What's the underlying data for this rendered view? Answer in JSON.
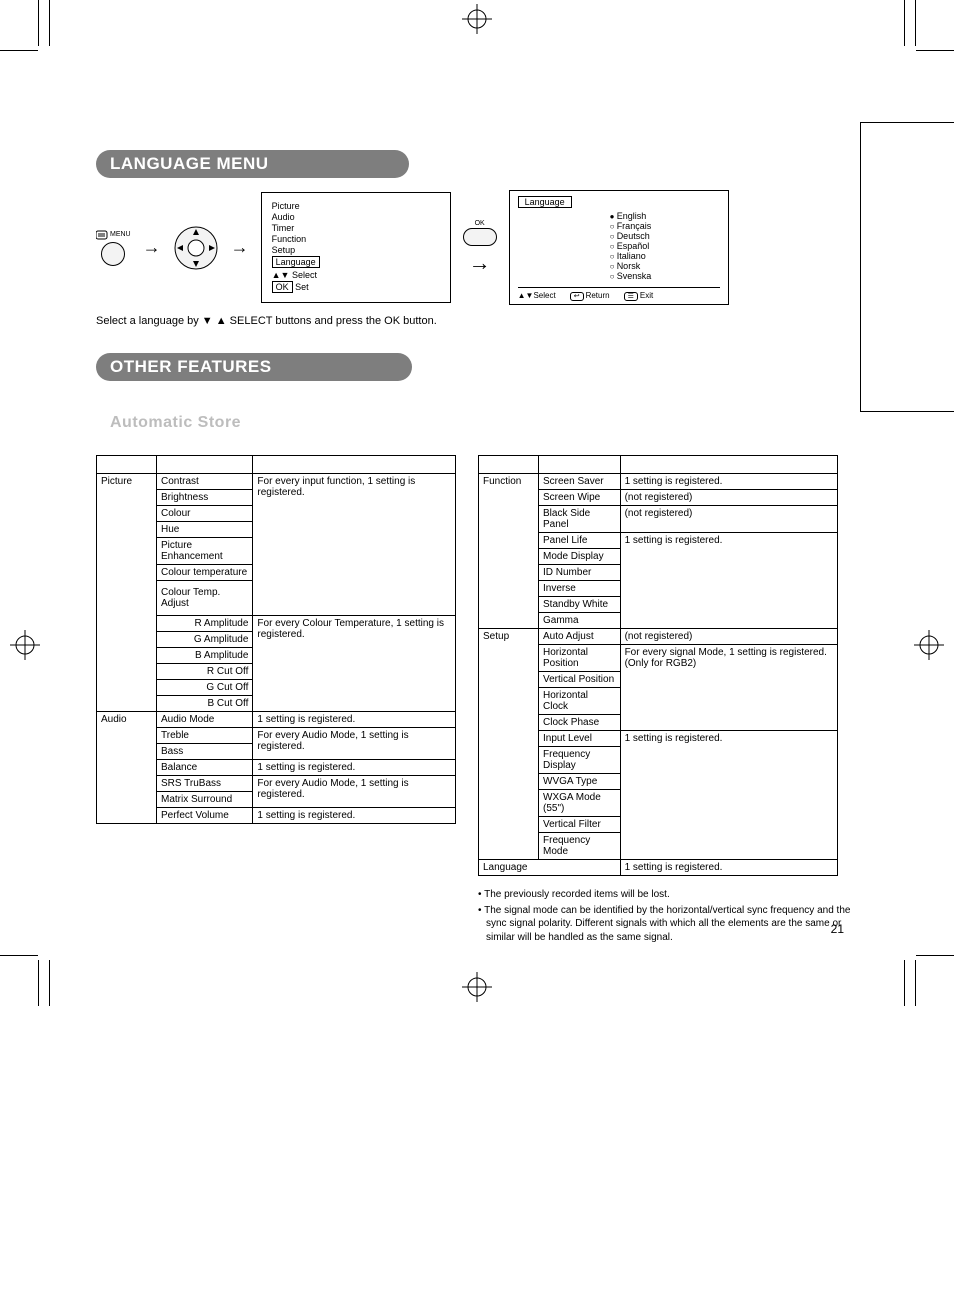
{
  "page_number": "21",
  "headers": {
    "language_menu": "LANGUAGE MENU",
    "other_features": "OTHER FEATURES",
    "automatic_store": "Automatic Store"
  },
  "flow": {
    "menu_button_label": "MENU",
    "ok_button_label": "OK",
    "osd_main": {
      "items": [
        "Picture",
        "Audio",
        "Timer",
        "Function",
        "Setup",
        "Language"
      ],
      "select_hint": "Select",
      "set_hint": "Set",
      "ok_label": "OK"
    },
    "osd_language": {
      "title": "Language",
      "options": [
        "English",
        "Français",
        "Deutsch",
        "Español",
        "Italiano",
        "Norsk",
        "Svenska"
      ],
      "selected_index": 0,
      "footer_select": "Select",
      "footer_return": "Return",
      "footer_exit": "Exit"
    }
  },
  "instruction_text": "Select a language by ▼ ▲ SELECT buttons and press the OK button.",
  "settings_left": {
    "groups": [
      {
        "category": "Picture",
        "rows": [
          {
            "name": "Contrast",
            "note_ref": 0
          },
          {
            "name": "Brightness"
          },
          {
            "name": "Colour"
          },
          {
            "name": "Hue"
          },
          {
            "name": "Picture Enhancement"
          },
          {
            "name": "Colour temperature"
          },
          {
            "name": "Colour Temp. Adjust"
          },
          {
            "name": "R Amplitude",
            "indent": true,
            "note_ref": 1
          },
          {
            "name": "G Amplitude",
            "indent": true
          },
          {
            "name": "B Amplitude",
            "indent": true
          },
          {
            "name": "R Cut Off",
            "indent": true
          },
          {
            "name": "G Cut Off",
            "indent": true
          },
          {
            "name": "B Cut Off",
            "indent": true
          }
        ],
        "notes": [
          "For every input function, 1 setting is registered.",
          "For every Colour Temperature, 1 setting is registered."
        ]
      },
      {
        "category": "Audio",
        "rows": [
          {
            "name": "Audio Mode",
            "note": "1 setting is registered."
          },
          {
            "name": "Treble",
            "note_ref": 0
          },
          {
            "name": "Bass"
          },
          {
            "name": "Balance",
            "note": "1 setting is registered."
          },
          {
            "name": "SRS TruBass",
            "note_ref": 1
          },
          {
            "name": "Matrix Surround"
          },
          {
            "name": "Perfect Volume",
            "note": "1 setting is registered."
          }
        ],
        "notes": [
          "For every Audio Mode, 1 setting is registered.",
          "For every Audio Mode, 1 setting is registered."
        ]
      }
    ]
  },
  "settings_right": {
    "groups": [
      {
        "category": "Function",
        "rows": [
          {
            "name": "Screen Saver",
            "note": "1 setting is registered."
          },
          {
            "name": "Screen Wipe",
            "note": "(not registered)"
          },
          {
            "name": "Black Side Panel",
            "note": "(not registered)"
          },
          {
            "name": "Panel Life",
            "note_ref": 0
          },
          {
            "name": "Mode Display"
          },
          {
            "name": "ID Number"
          },
          {
            "name": "Inverse"
          },
          {
            "name": "Standby White"
          },
          {
            "name": "Gamma"
          }
        ],
        "notes": [
          "1 setting is registered."
        ]
      },
      {
        "category": "Setup",
        "rows": [
          {
            "name": "Auto Adjust",
            "note": "(not registered)"
          },
          {
            "name": "Horizontal Position",
            "note_ref": 0
          },
          {
            "name": "Vertical Position"
          },
          {
            "name": "Horizontal Clock"
          },
          {
            "name": "Clock Phase"
          },
          {
            "name": "Input Level",
            "note_ref": 1
          },
          {
            "name": "Frequency Display"
          },
          {
            "name": "WVGA Type"
          },
          {
            "name": "WXGA Mode (55\")"
          },
          {
            "name": "Vertical Filter"
          },
          {
            "name": "Frequency Mode"
          }
        ],
        "notes": [
          "For every signal Mode, 1 setting is registered. (Only for RGB2)",
          "1 setting is registered."
        ]
      },
      {
        "category": "Language",
        "rows": [],
        "single_note": "1 setting is registered."
      }
    ]
  },
  "bullet_notes": [
    "The previously recorded items will be lost.",
    "The signal mode can be identified by the horizontal/vertical sync frequency and the sync signal polarity. Different signals with which all the elements are the same or similar will be handled as the same signal."
  ]
}
